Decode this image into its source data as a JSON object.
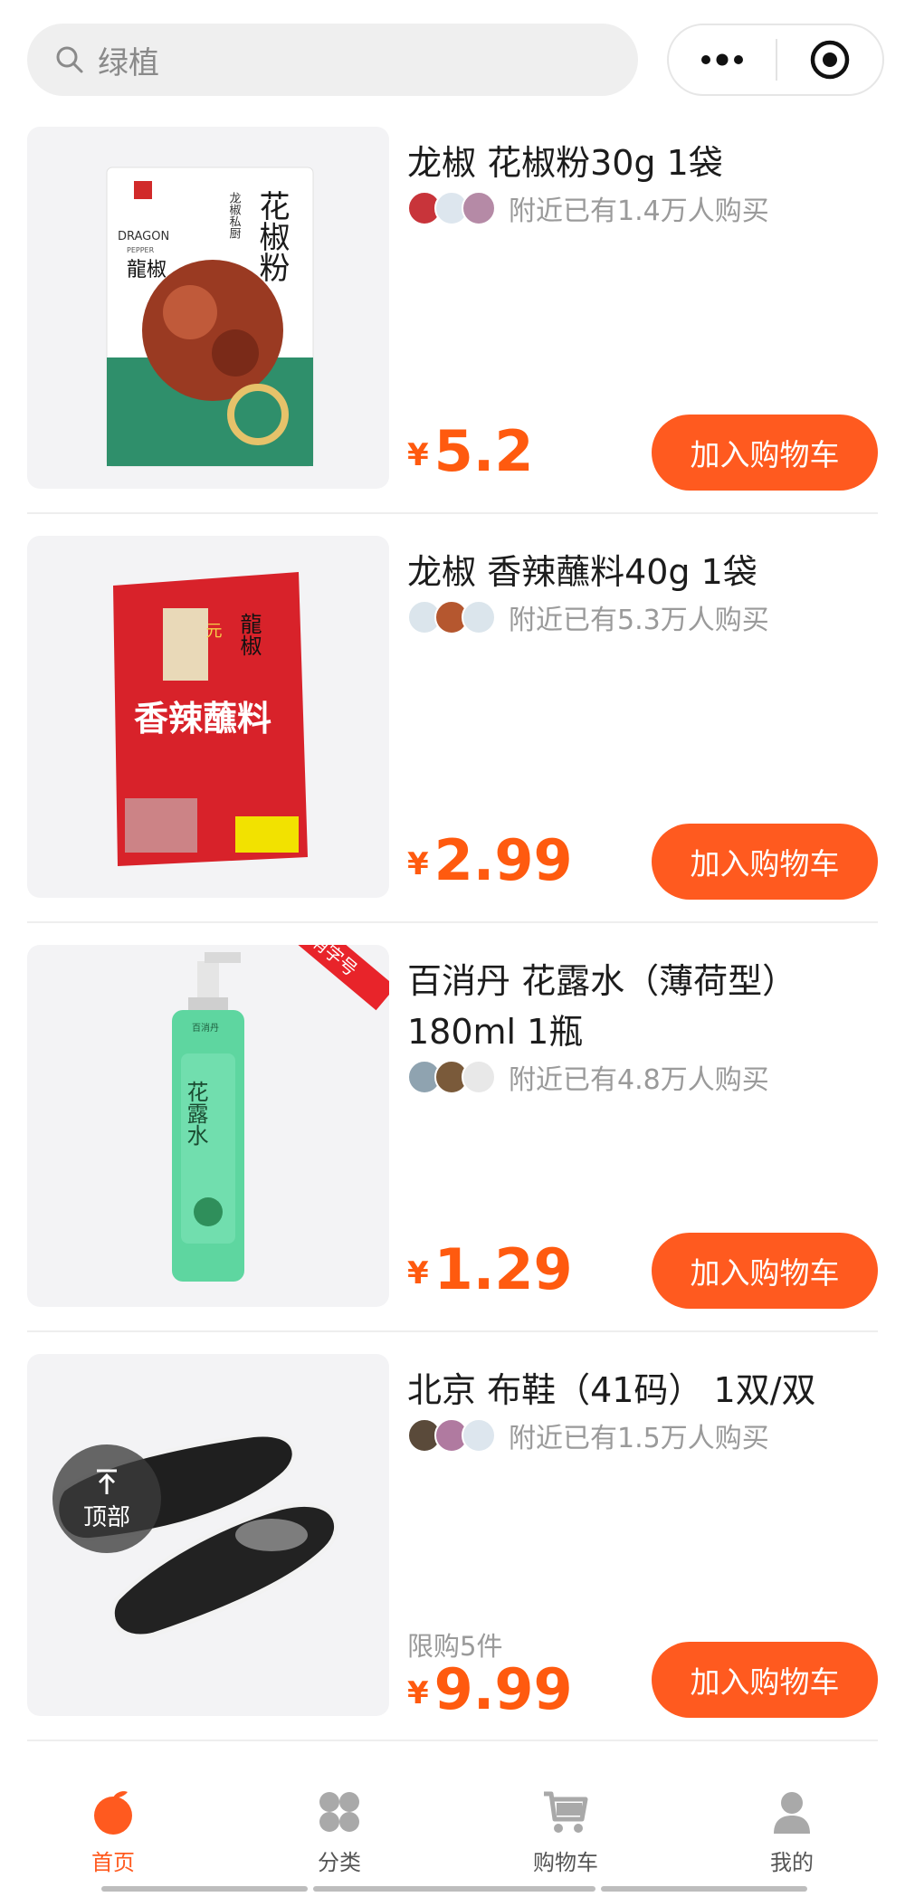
{
  "search": {
    "placeholder": "绿植",
    "icon": "search-icon"
  },
  "capsule": {
    "more_icon": "more-dots-icon",
    "target_icon": "target-icon"
  },
  "products": [
    {
      "title": "龙椒 花椒粉30g 1袋",
      "buyers_text": "附近已有1.4万人购买",
      "price_symbol": "¥",
      "price": "5.2",
      "button": "加入购物车",
      "image_text": {
        "brand_en": "DRAGON",
        "brand_en2": "PEPPER",
        "brand_cn": "龍椒",
        "product_name": "花椒粉",
        "subtitle": "龙椒私厨"
      }
    },
    {
      "title": "龙椒 香辣蘸料40g 1袋",
      "buyers_text": "附近已有5.3万人购买",
      "price_symbol": "¥",
      "price": "2.99",
      "button": "加入购物车",
      "image_text": {
        "product_name": "香辣蘸料",
        "brand_cn": "龍椒",
        "tag": "元"
      }
    },
    {
      "title": "百消丹 花露水（薄荷型）180ml 1瓶",
      "buyers_text": "附近已有4.8万人购买",
      "price_symbol": "¥",
      "price": "1.29",
      "button": "加入购物车",
      "badge": "消字号",
      "image_text": {
        "product_name": "花露水",
        "brand_cn": "百消丹"
      }
    },
    {
      "title": "北京 布鞋（41码） 1双/双",
      "buyers_text": "附近已有1.5万人购买",
      "limit": "限购5件",
      "price_symbol": "¥",
      "price": "9.99",
      "button": "加入购物车"
    }
  ],
  "back_to_top": {
    "label": "顶部",
    "icon": "arrow-up-icon"
  },
  "tabbar": [
    {
      "label": "首页",
      "icon": "orange-home-icon",
      "active": true
    },
    {
      "label": "分类",
      "icon": "category-icon",
      "active": false
    },
    {
      "label": "购物车",
      "icon": "cart-icon",
      "active": false
    },
    {
      "label": "我的",
      "icon": "profile-icon",
      "active": false
    }
  ],
  "colors": {
    "accent": "#ff5a1f",
    "price": "#ff5a0f",
    "muted": "#9a9a9a"
  }
}
